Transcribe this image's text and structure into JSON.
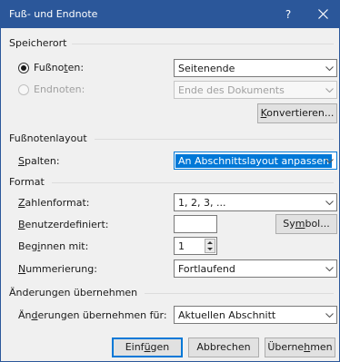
{
  "window": {
    "title": "Fuß- und Endnote",
    "help": "?"
  },
  "speicherort": {
    "heading": "Speicherort",
    "fussnoten": {
      "label_pre": "Fußno",
      "label_u": "t",
      "label_post": "en:",
      "value": "Seitenende",
      "selected": true
    },
    "endnoten": {
      "label": "Endnoten:",
      "value": "Ende des Dokuments",
      "enabled": false
    },
    "konvertieren": {
      "u": "K",
      "rest": "onvertieren..."
    }
  },
  "layout": {
    "heading": "Fußnotenlayout",
    "spalten": {
      "u": "S",
      "rest": "palten:",
      "value": "An Abschnittslayout anpassen"
    }
  },
  "format": {
    "heading": "Format",
    "zahlenformat": {
      "u": "Z",
      "rest": "ahlenformat:",
      "value": "1, 2, 3, ..."
    },
    "benutzerdefiniert": {
      "u": "B",
      "rest": "enutzerdefiniert:",
      "value": ""
    },
    "symbol": {
      "pre": "Sy",
      "u": "m",
      "post": "bol..."
    },
    "beginnen": {
      "pre": "Beg",
      "u": "i",
      "post": "nnen mit:",
      "value": "1"
    },
    "nummerierung": {
      "u": "N",
      "rest": "ummerierung:",
      "value": "Fortlaufend"
    }
  },
  "aenderungen": {
    "heading": "Änderungen übernehmen",
    "label": {
      "pre": "Än",
      "u": "d",
      "post": "erungen übernehmen für:"
    },
    "value": "Aktuellen Abschnitt"
  },
  "buttons": {
    "einfuegen": {
      "pre": "Einf",
      "u": "ü",
      "post": "gen"
    },
    "abbrechen": "Abbrechen",
    "uebernehmen": {
      "pre": "Überne",
      "u": "h",
      "post": "men"
    }
  },
  "colors": {
    "titlebar": "#2b579a",
    "focus": "#0078d7",
    "dialog_bg": "#f0f0f0"
  },
  "icons": [
    "close-icon",
    "chevron-down-icon",
    "spin-up-icon",
    "spin-down-icon"
  ]
}
